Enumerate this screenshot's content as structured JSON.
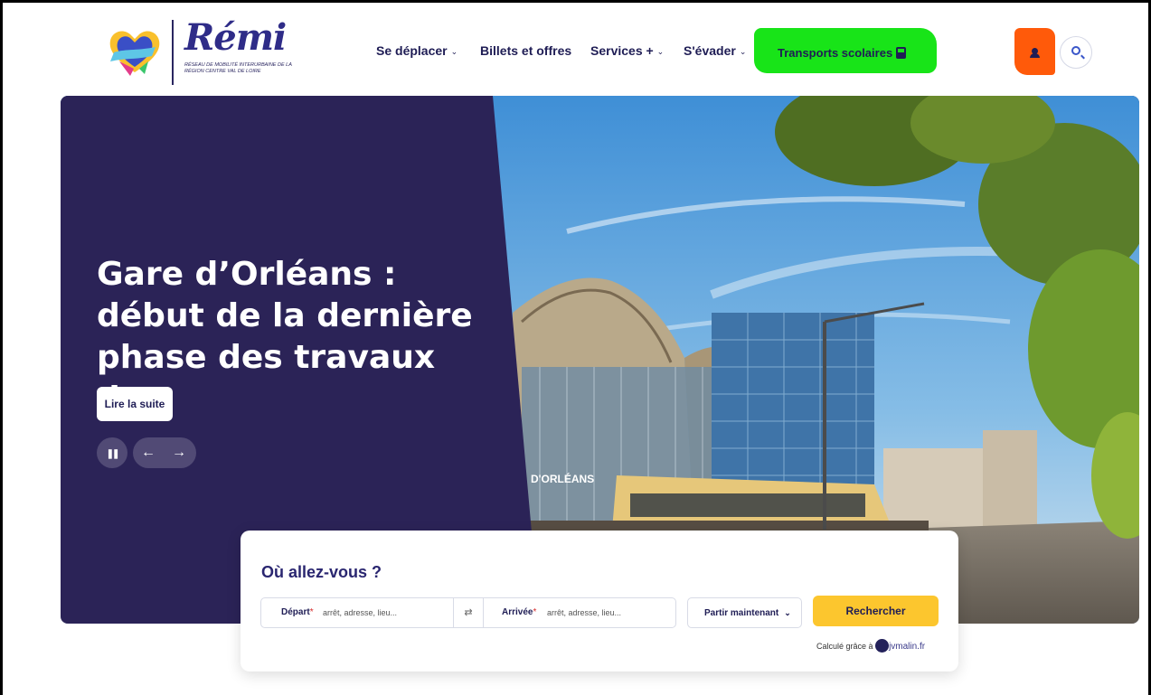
{
  "brand": {
    "name": "Rémi",
    "tagline": "Réseau de mobilité interurbaine de la région Centre Val de Loire"
  },
  "nav": {
    "items": [
      {
        "label": "Se déplacer",
        "has_menu": true
      },
      {
        "label": "Billets et offres",
        "has_menu": false
      },
      {
        "label": "Services +",
        "has_menu": true
      },
      {
        "label": "S'évader",
        "has_menu": true
      }
    ],
    "highlight": {
      "label": "Transports scolaires",
      "icon": "bus-icon"
    }
  },
  "header_actions": {
    "account_icon": "user-icon",
    "search_icon": "search-icon"
  },
  "hero": {
    "title": "Gare d’Orléans : début de la dernière phase des travaux d…",
    "read_more": "Lire la suite",
    "photo_sign": "D'ORLÉANS",
    "controls": {
      "pause": "❚❚",
      "prev": "←",
      "next": "→"
    }
  },
  "search": {
    "title": "Où allez-vous ?",
    "departure": {
      "label": "Départ",
      "required_mark": "*",
      "placeholder": "arrêt, adresse, lieu..."
    },
    "arrival": {
      "label": "Arrivée",
      "required_mark": "*",
      "placeholder": "arrêt, adresse, lieu..."
    },
    "swap_icon": "⇄",
    "when": {
      "value": "Partir maintenant"
    },
    "submit": "Rechercher",
    "credit": {
      "text": "Calculé grâce à",
      "brand": "jvmalin.fr"
    }
  },
  "colors": {
    "navy": "#2b2357",
    "accent_yellow": "#fcc62e",
    "highlight_green": "#18e418",
    "account_orange": "#ff5a0a",
    "brand_blue": "#2f2c88"
  }
}
